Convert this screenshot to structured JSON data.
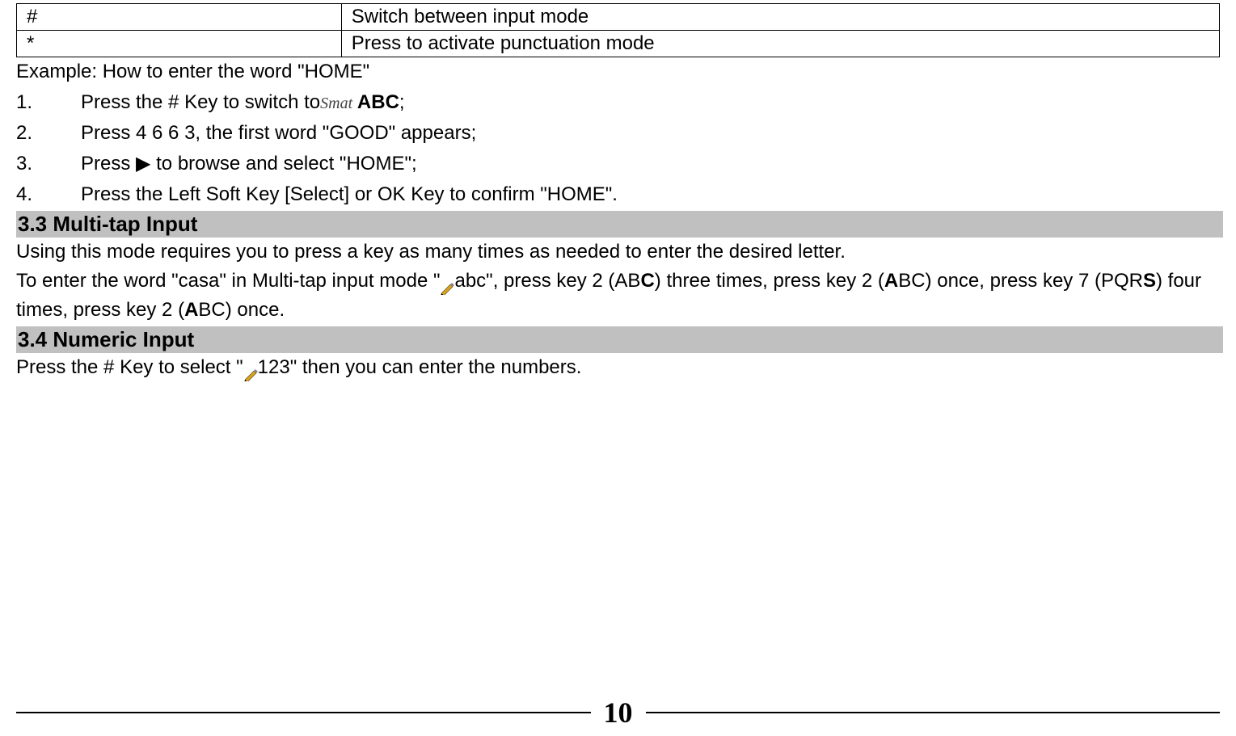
{
  "table": {
    "rows": [
      {
        "key": "#",
        "desc": "Switch between input mode"
      },
      {
        "key": "*",
        "desc": "Press to activate punctuation mode"
      }
    ]
  },
  "example_heading": "Example: How to enter the word \"HOME\"",
  "steps": [
    {
      "num": "1.",
      "pre": "Press the # Key to switch to",
      "icon": "smart",
      "post_bold": " ABC",
      "end": ";"
    },
    {
      "num": "2.",
      "text": "Press 4 6 6 3, the first word \"GOOD\" appears;"
    },
    {
      "num": "3.",
      "text": "Press  ▶  to browse and select \"HOME\";"
    },
    {
      "num": "4.",
      "text": "Press the Left Soft Key [Select] or OK Key to confirm \"HOME\"."
    }
  ],
  "section33_title": "3.3 Multi-tap Input",
  "section33_body_1": "Using this mode requires you to press a key as many times as needed to enter the desired letter.",
  "section33_body_2a": "To enter the word \"casa\" in Multi-tap input mode \"",
  "section33_body_2b": "abc\", press key 2 (AB",
  "section33_body_2c": "C",
  "section33_body_2d": ") three times, press key 2 (",
  "section33_body_2e": "A",
  "section33_body_2f": "BC) once, press key 7 (PQR",
  "section33_body_2g": "S",
  "section33_body_2h": ") four times, press key 2 (",
  "section33_body_2i": "A",
  "section33_body_2j": "BC) once.",
  "section34_title": "3.4 Numeric Input",
  "section34_body_a": "Press the # Key to select \"",
  "section34_body_b": "123\" then you can enter the numbers.",
  "page_number": "10"
}
